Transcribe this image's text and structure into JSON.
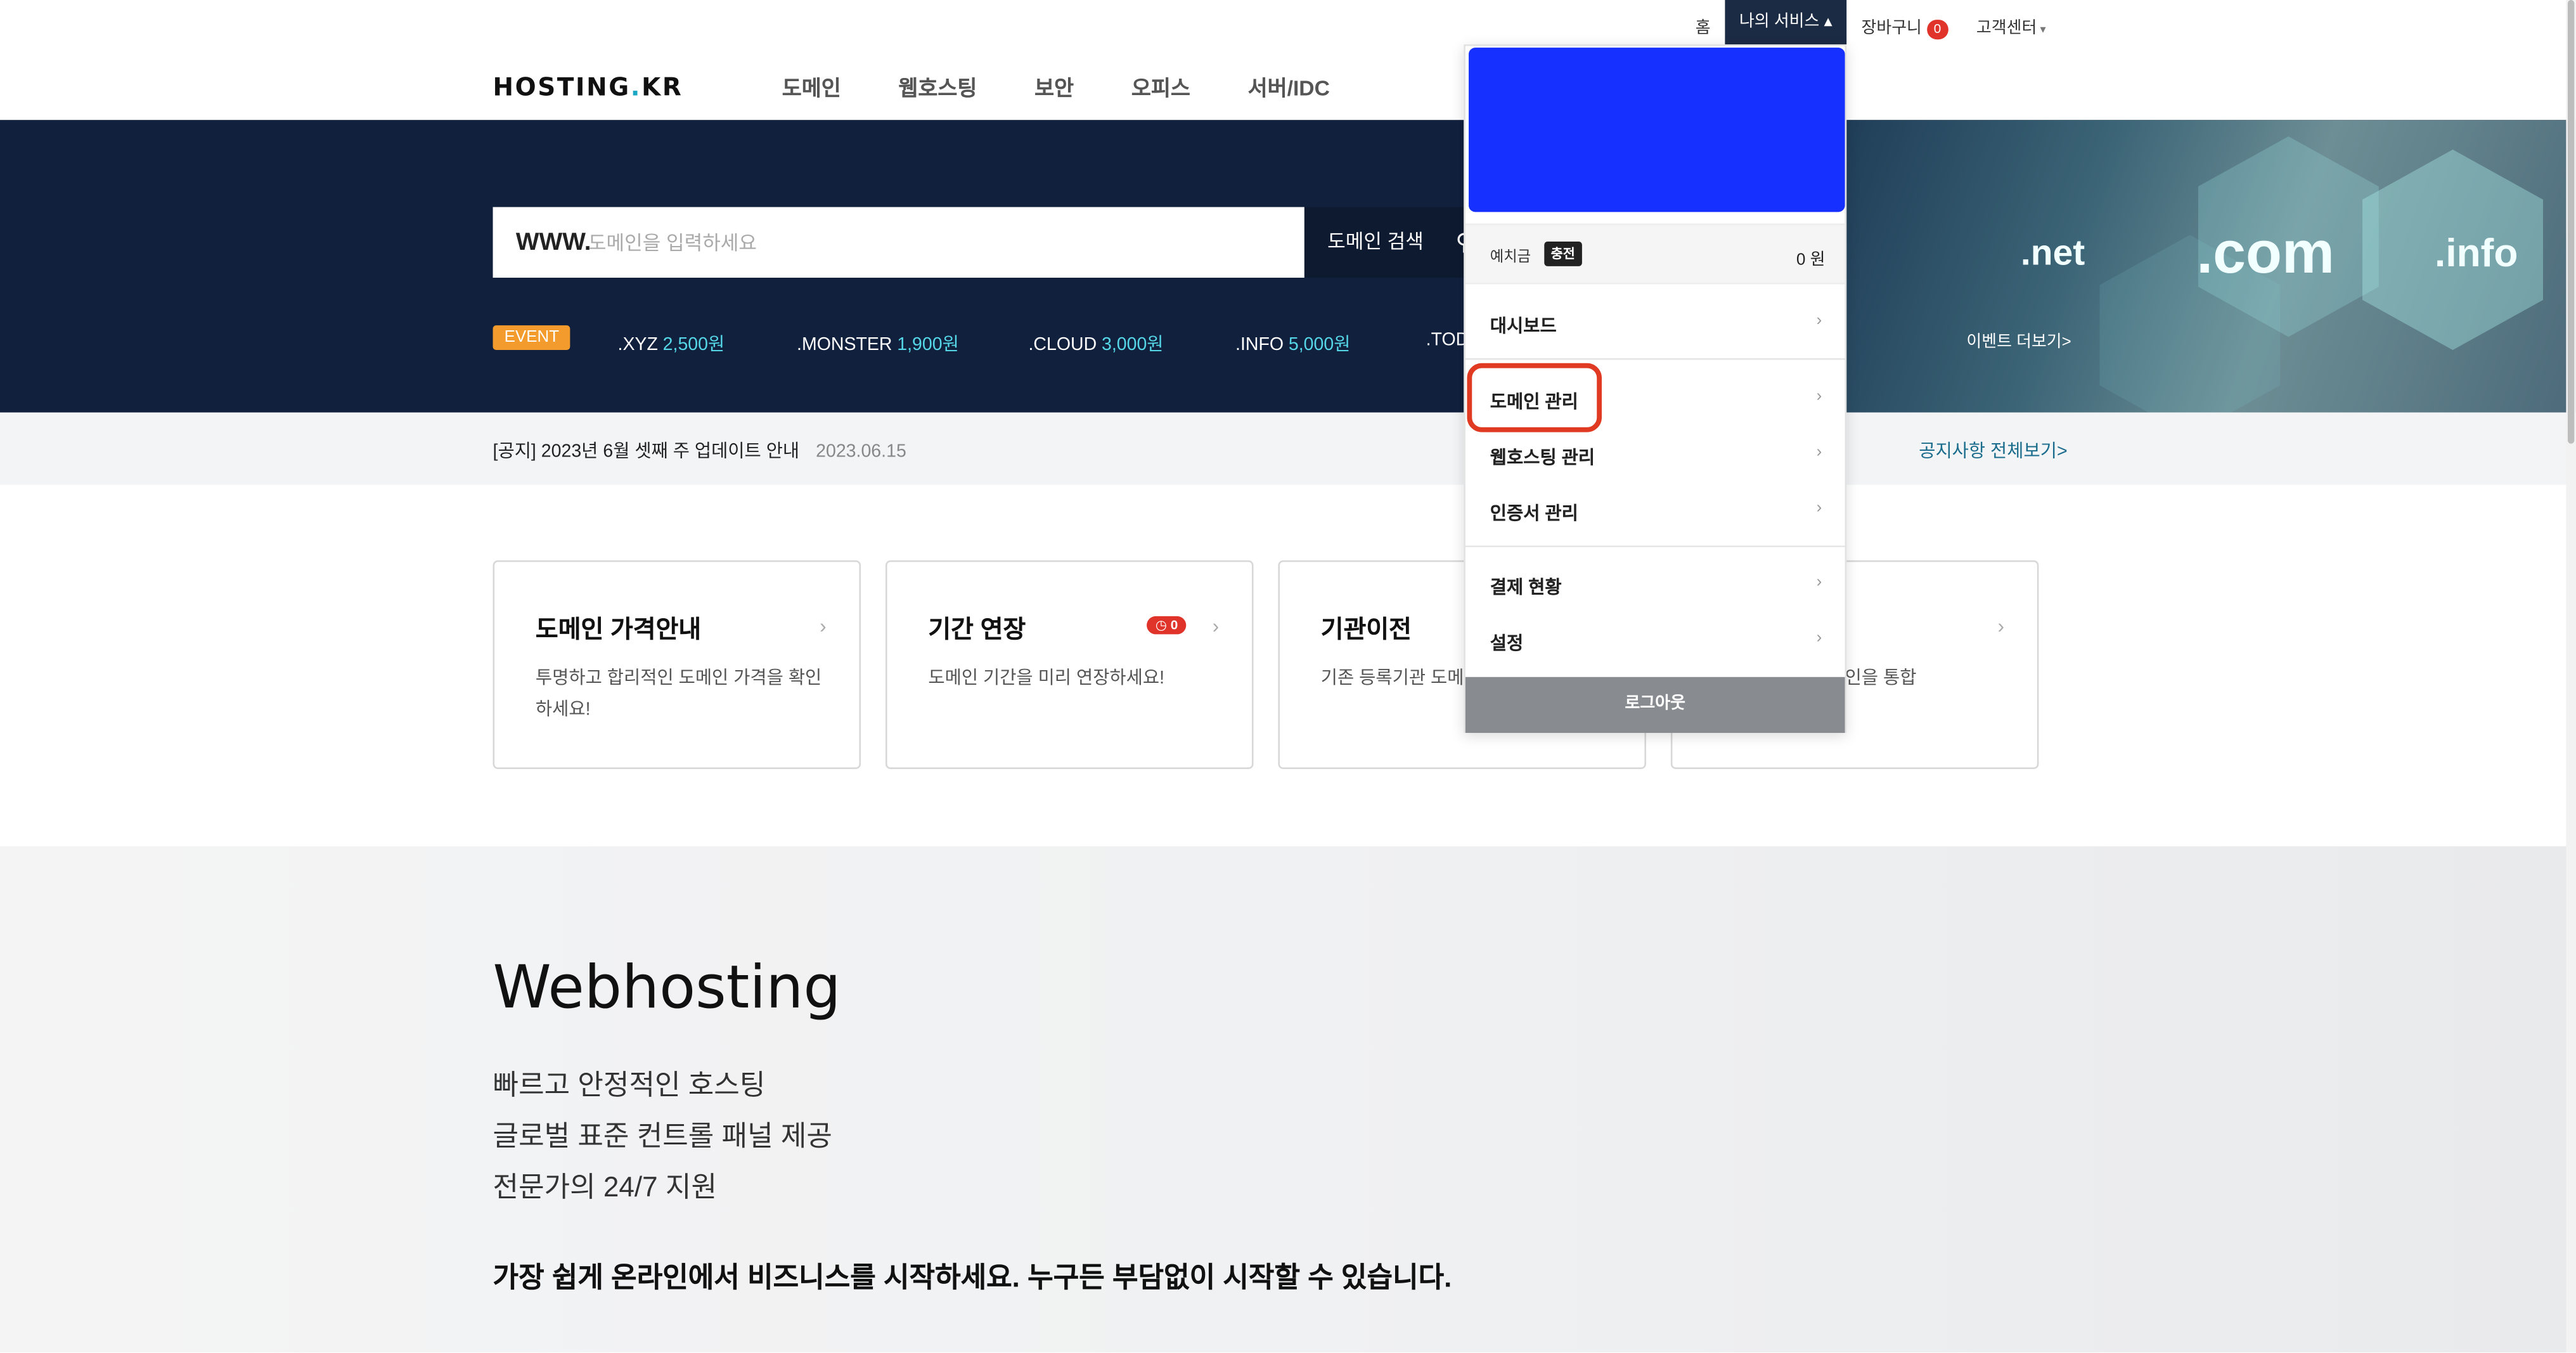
{
  "util": {
    "home": "홈",
    "my_service": "나의 서비스 ▴",
    "cart": "장바구니",
    "cart_count": "0",
    "support": "고객센터",
    "support_caret": "▾"
  },
  "header": {
    "logo_a": "HOSTING",
    "logo_dot": ".",
    "logo_b": "KR",
    "nav": [
      "도메인",
      "웹호스팅",
      "보안",
      "오피스",
      "서버/IDC"
    ]
  },
  "hero": {
    "search_prefix": "WWW.",
    "search_placeholder": "도메인을 입력하세요",
    "search_button": "도메인 검색",
    "event_tag": "EVENT",
    "prices": [
      {
        "tld": ".XYZ",
        "price": "2,500원"
      },
      {
        "tld": ".MONSTER",
        "price": "1,900원"
      },
      {
        "tld": ".CLOUD",
        "price": "3,000원"
      },
      {
        "tld": ".INFO",
        "price": "5,000원"
      },
      {
        "tld": ".TOD",
        "price": ""
      }
    ],
    "banner_tlds": [
      ".net",
      ".com",
      ".info"
    ],
    "event_more": "이벤트 더보기>"
  },
  "notice": {
    "text": "[공지] 2023년 6월 셋째 주 업데이트 안내",
    "date": "2023.06.15",
    "all": "공지사항 전체보기>"
  },
  "cards": [
    {
      "title": "도메인 가격안내",
      "desc": "투명하고 합리적인 도메인 가격을 확인하세요!",
      "badge": ""
    },
    {
      "title": "기간 연장",
      "desc": "도메인 기간을 미리 연장하세요!",
      "badge": "0"
    },
    {
      "title": "기관이전",
      "desc": "기존 등록기관 도메 옮기세요!",
      "badge": ""
    },
    {
      "title": "",
      "desc": "인을 통합",
      "badge": ""
    }
  ],
  "webhosting": {
    "title": "Webhosting",
    "lines": [
      "빠르고 안정적인 호스팅",
      "글로벌 표준 컨트롤 패널 제공",
      "전문가의 24/7 지원"
    ],
    "tagline": "가장 쉽게 온라인에서 비즈니스를 시작하세요. 누구든 부담없이 시작할 수 있습니다."
  },
  "dropdown": {
    "deposit_label": "예치금",
    "charge_label": "충전",
    "deposit_amount": "0 원",
    "items": [
      "대시보드",
      "도메인 관리",
      "웹호스팅 관리",
      "인증서 관리",
      "결제 현황",
      "설정"
    ],
    "logout": "로그아웃",
    "banner_color": "#1631ff"
  },
  "colors": {
    "hero_bg": "#11203d",
    "accent_orange": "#f39b2c",
    "price_cyan": "#55d7e8",
    "highlight_red": "#e03a22"
  }
}
